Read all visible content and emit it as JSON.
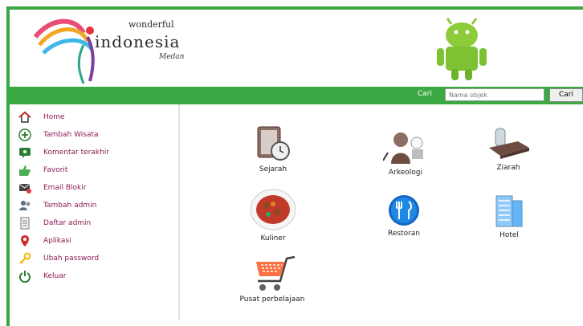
{
  "brand": {
    "small": "wonderful",
    "name": "indonesia",
    "city": "Medan"
  },
  "search": {
    "label": "Cari",
    "placeholder": "Nama objek",
    "button": "Cari"
  },
  "sidebar": {
    "items": [
      {
        "label": "Home",
        "icon": "home-icon"
      },
      {
        "label": "Tambah Wisata",
        "icon": "add-circle-icon"
      },
      {
        "label": "Komentar terakhir",
        "icon": "comment-icon"
      },
      {
        "label": "Favorit",
        "icon": "thumbs-up-icon"
      },
      {
        "label": "Email Blokir",
        "icon": "blocked-email-icon"
      },
      {
        "label": "Tambah admin",
        "icon": "add-user-icon"
      },
      {
        "label": "Daftar admin",
        "icon": "list-document-icon"
      },
      {
        "label": "Aplikasi",
        "icon": "location-pin-icon"
      },
      {
        "label": "Ubah password",
        "icon": "key-icon"
      },
      {
        "label": "Keluar",
        "icon": "power-icon"
      }
    ]
  },
  "categories": [
    {
      "label": "Sejarah",
      "icon": "history-clock-icon"
    },
    {
      "label": "Arkeologi",
      "icon": "archaeology-icon"
    },
    {
      "label": "Ziarah",
      "icon": "grave-icon"
    },
    {
      "label": "Kuliner",
      "icon": "food-bowl-icon"
    },
    {
      "label": "Restoran",
      "icon": "restaurant-icon"
    },
    {
      "label": "Hotel",
      "icon": "hotel-icon"
    },
    {
      "label": "Pusat perbelajaan",
      "icon": "shopping-cart-icon"
    }
  ]
}
